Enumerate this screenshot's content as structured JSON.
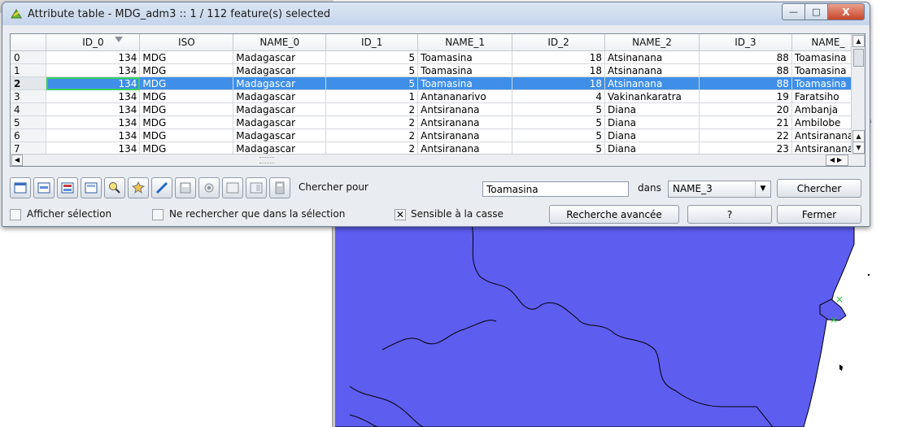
{
  "window": {
    "title": "Attribute table - MDG_adm3 :: 1 / 112 feature(s) selected",
    "buttons": {
      "minimize": "—",
      "maximize": "□",
      "close": "X"
    }
  },
  "table": {
    "columns": [
      "ID_0",
      "ISO",
      "NAME_0",
      "ID_1",
      "NAME_1",
      "ID_2",
      "NAME_2",
      "ID_3",
      "NAME_"
    ],
    "rows": [
      {
        "idx": "0",
        "cells": [
          "134",
          "MDG",
          "Madagascar",
          "5",
          "Toamasina",
          "18",
          "Atsinanana",
          "88",
          "Toamasina"
        ]
      },
      {
        "idx": "1",
        "cells": [
          "134",
          "MDG",
          "Madagascar",
          "5",
          "Toamasina",
          "18",
          "Atsinanana",
          "88",
          "Toamasina"
        ]
      },
      {
        "idx": "2",
        "cells": [
          "134",
          "MDG",
          "Madagascar",
          "5",
          "Toamasina",
          "18",
          "Atsinanana",
          "88",
          "Toamasina"
        ],
        "selected": true
      },
      {
        "idx": "3",
        "cells": [
          "134",
          "MDG",
          "Madagascar",
          "1",
          "Antananarivo",
          "4",
          "Vakinankaratra",
          "19",
          "Faratsiho"
        ]
      },
      {
        "idx": "4",
        "cells": [
          "134",
          "MDG",
          "Madagascar",
          "2",
          "Antsiranana",
          "5",
          "Diana",
          "20",
          "Ambanja"
        ]
      },
      {
        "idx": "5",
        "cells": [
          "134",
          "MDG",
          "Madagascar",
          "2",
          "Antsiranana",
          "5",
          "Diana",
          "21",
          "Ambilobe"
        ]
      },
      {
        "idx": "6",
        "cells": [
          "134",
          "MDG",
          "Madagascar",
          "2",
          "Antsiranana",
          "5",
          "Diana",
          "22",
          "Antsiranana"
        ]
      },
      {
        "idx": "7",
        "cells": [
          "134",
          "MDG",
          "Madagascar",
          "2",
          "Antsiranana",
          "5",
          "Diana",
          "23",
          "Antsiranana"
        ]
      }
    ]
  },
  "search": {
    "label": "Chercher pour",
    "value": "Toamasina",
    "in_label": "dans",
    "field": "NAME_3",
    "button": "Chercher"
  },
  "options": {
    "show_selected": "Afficher sélection",
    "search_selected_only": "Ne rechercher que dans la sélection",
    "case_sensitive": "Sensible à la casse",
    "case_sensitive_checked": true,
    "advanced_search": "Recherche avancée",
    "help": "?",
    "close": "Fermer"
  },
  "toolbar_icons": [
    "table-icon",
    "zoom-selection-icon",
    "invert-selection-icon",
    "move-top-icon",
    "search-icon",
    "pan-selection-icon",
    "edit-pencil-icon",
    "save-icon",
    "delete-icon",
    "new-column-icon",
    "delete-column-icon",
    "calculator-icon"
  ],
  "colors": {
    "selection": "#3f8fe8",
    "map_fill": "#5d5df0",
    "focus_outline": "#3bcf5f"
  }
}
